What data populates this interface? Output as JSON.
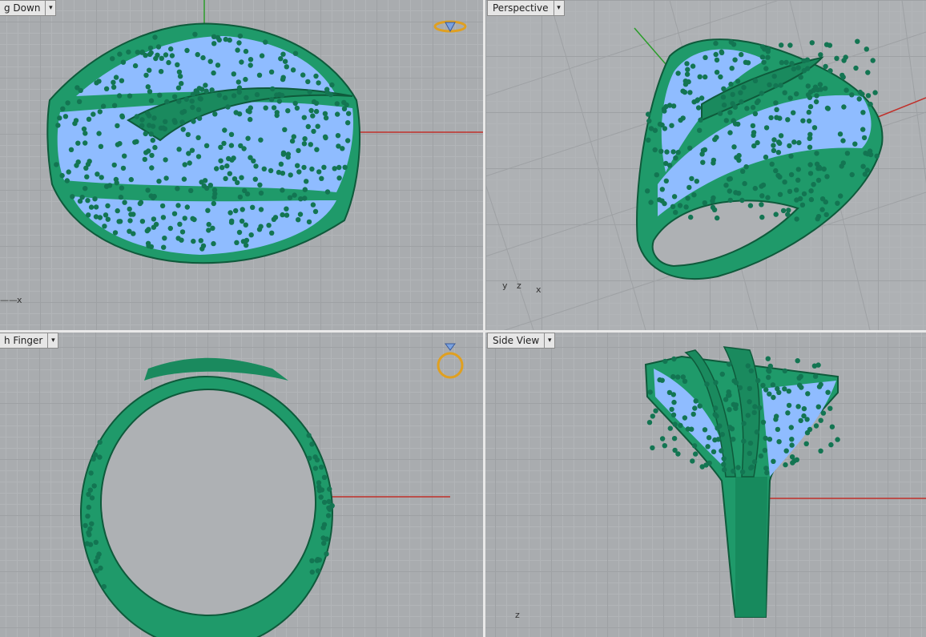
{
  "viewports": {
    "top_left": {
      "title": "g Down"
    },
    "top_right": {
      "title": "Perspective",
      "axis_labels": [
        "y",
        "z",
        "x"
      ]
    },
    "bottom_left": {
      "title": "h Finger"
    },
    "bottom_right": {
      "title": "Side View",
      "axis_labels": [
        "z"
      ]
    },
    "top_left_axis": "x",
    "dropdown_glyph": "▾"
  },
  "colors": {
    "metal": "#1f9a6a",
    "metal_dark": "#0e5a3b",
    "gem": "#8fbcff",
    "bead": "#137552",
    "axis_red": "#c0302a",
    "axis_green": "#2a9d2a",
    "viewport_bg": "#a9acaf"
  }
}
